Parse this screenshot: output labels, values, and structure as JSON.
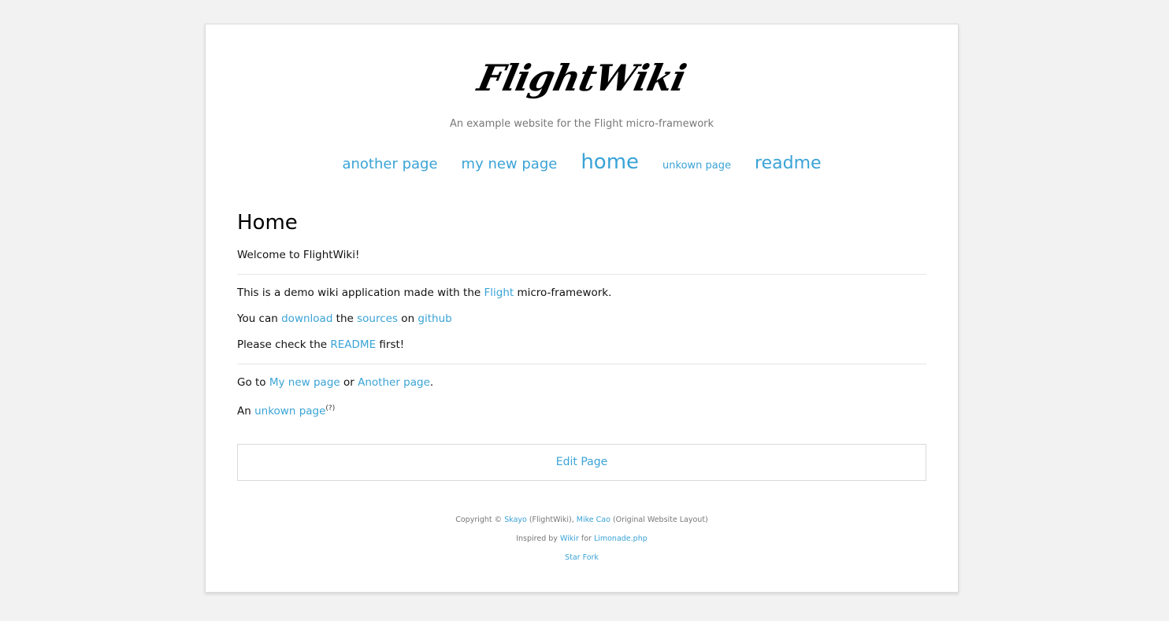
{
  "site": {
    "logo": "FlightWiki",
    "tagline": "An example website for the Flight micro-framework"
  },
  "nav": [
    {
      "label": "another page"
    },
    {
      "label": "my new page"
    },
    {
      "label": "home"
    },
    {
      "label": "unkown page"
    },
    {
      "label": "readme"
    }
  ],
  "page": {
    "title": "Home",
    "welcome": "Welcome to FlightWiki!",
    "line1": {
      "pre": "This is a demo wiki application made with the ",
      "link": "Flight",
      "post": " micro-framework."
    },
    "line2": {
      "pre": "You can ",
      "link1": "download",
      "mid1": " the ",
      "link2": "sources",
      "mid2": " on ",
      "link3": "github"
    },
    "line3": {
      "pre": "Please check the ",
      "link": "README",
      "post": " first!"
    },
    "line4": {
      "pre": "Go to ",
      "link1": "My new page",
      "mid": " or ",
      "link2": "Another page",
      "post": "."
    },
    "line5": {
      "pre": "An ",
      "link": "unkown page",
      "sup": "(?)"
    }
  },
  "edit": {
    "label": "Edit Page"
  },
  "footer": {
    "copyright_pre": "Copyright © ",
    "author1": "Skayo",
    "author1_note": " (FlightWiki), ",
    "author2": "Mike Cao",
    "author2_note": " (Original Website Layout)",
    "inspired_pre": "Inspired by ",
    "inspired_link1": "Wikir",
    "inspired_mid": " for ",
    "inspired_link2": "Limonade.php",
    "star": "Star",
    "fork": "Fork"
  },
  "colors": {
    "link": "#3aa3d6",
    "background": "#f2f2f2"
  }
}
